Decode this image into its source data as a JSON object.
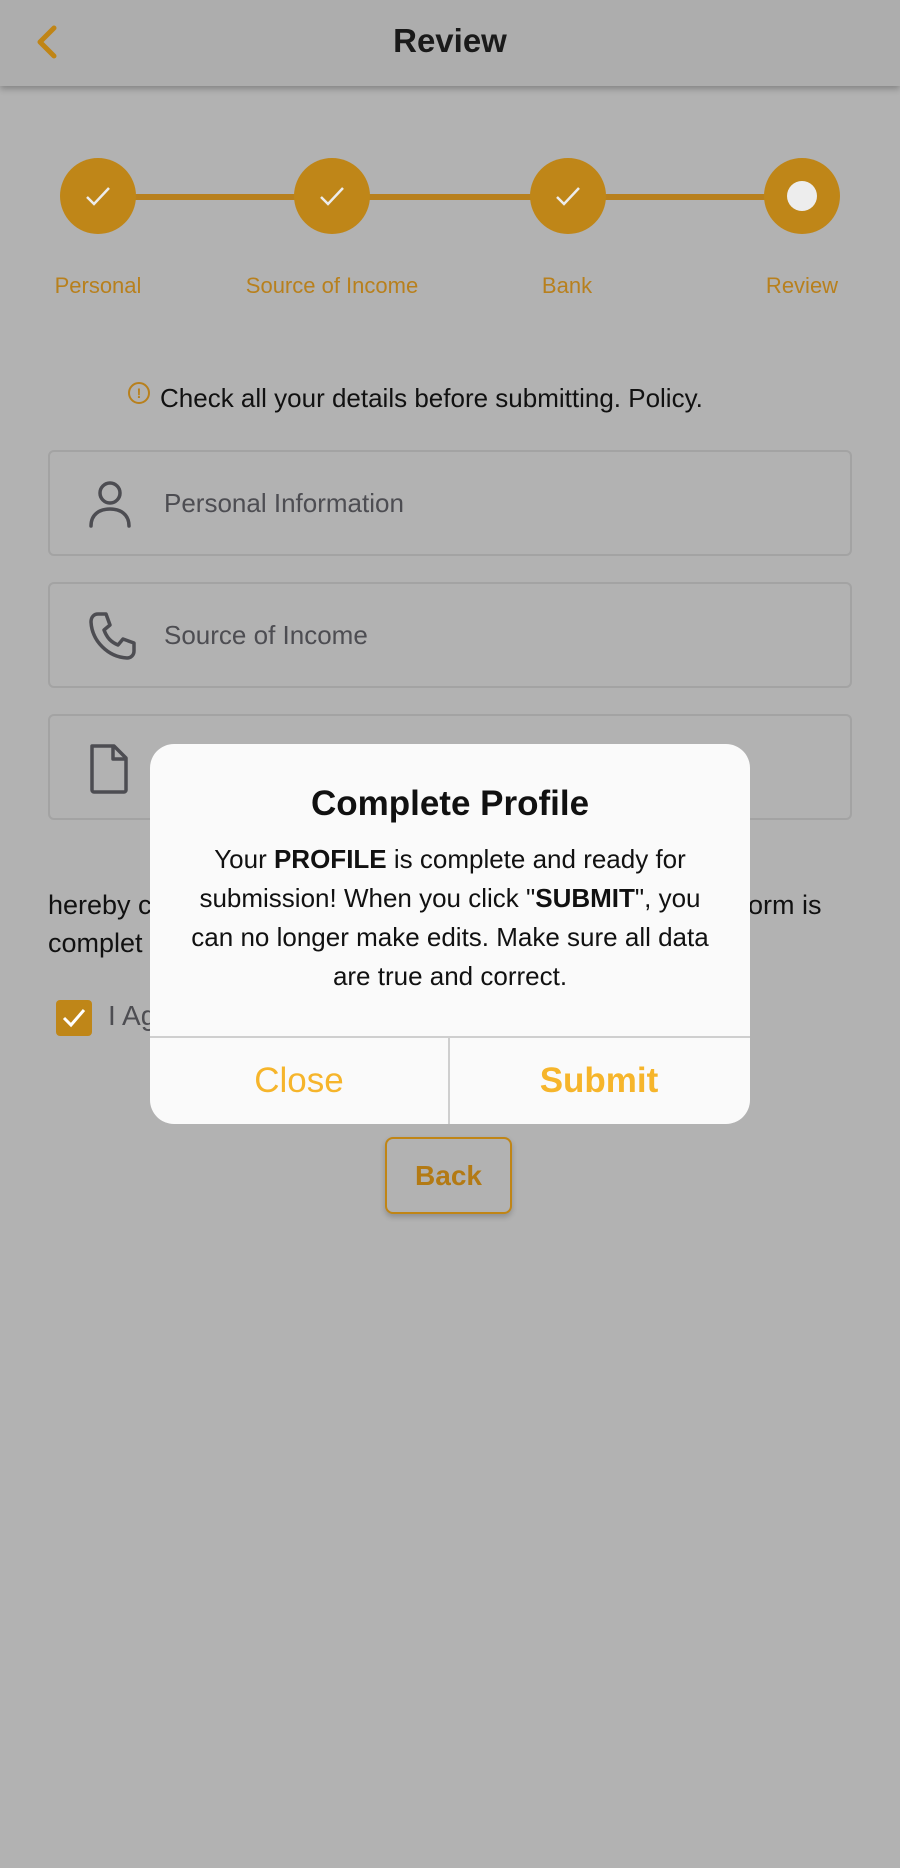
{
  "header": {
    "title": "Review",
    "back_icon": "chevron-left-icon"
  },
  "stepper": {
    "steps": [
      {
        "label": "Personal",
        "state": "done"
      },
      {
        "label": "Source of Income",
        "state": "done"
      },
      {
        "label": "Bank",
        "state": "done"
      },
      {
        "label": "Review",
        "state": "current"
      }
    ],
    "color": "#bf8618"
  },
  "notice": {
    "text": "Check all your details before submitting. Policy."
  },
  "sections": [
    {
      "label": "Personal Information",
      "icon": "user-icon"
    },
    {
      "label": "Source of Income",
      "icon": "phone-icon"
    },
    {
      "label": "",
      "icon": "document-icon"
    }
  ],
  "agreement": {
    "text_left_line1": "hereby c",
    "text_right_line1": "orm is",
    "text_left_line2": "complet",
    "checkbox_label": "I Ag",
    "checked": true
  },
  "back_button": {
    "label": "Back"
  },
  "modal": {
    "title": "Complete Profile",
    "body_part1": "Your ",
    "body_bold1": "PROFILE",
    "body_part2": " is complete and ready for submission! When you click \"",
    "body_bold2": "SUBMIT",
    "body_part3": "\", you can no longer make edits. Make sure all data are true and correct.",
    "close_label": "Close",
    "submit_label": "Submit",
    "accent": "#f6b52b"
  }
}
